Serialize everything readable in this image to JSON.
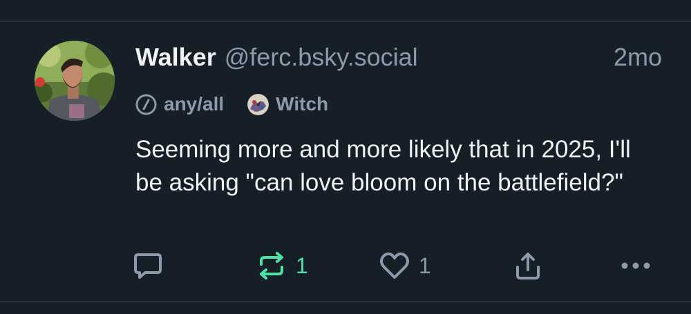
{
  "post": {
    "display_name": "Walker",
    "handle": "@ferc.bsky.social",
    "timestamp": "2mo",
    "labels": [
      {
        "text": "any/all",
        "icon": "slash-circle-icon"
      },
      {
        "text": "Witch",
        "icon": "witch-labeler-avatar"
      }
    ],
    "text": "Seeming more and more likely that in 2025, I'll be asking \"can love bloom on the battlefield?\""
  },
  "actions": {
    "reply": {
      "icon": "reply-bubble-icon",
      "count": ""
    },
    "repost": {
      "icon": "repost-icon",
      "count": "1",
      "color": "#4de3a4"
    },
    "like": {
      "icon": "heart-icon",
      "count": "1"
    },
    "share": {
      "icon": "share-icon"
    },
    "more": {
      "icon": "more-dots-icon"
    }
  },
  "colors": {
    "background": "#161e27",
    "divider": "#27313d",
    "primary_text": "#f1f3f5",
    "secondary_text": "#8d9aab",
    "repost_active": "#4de3a4"
  }
}
